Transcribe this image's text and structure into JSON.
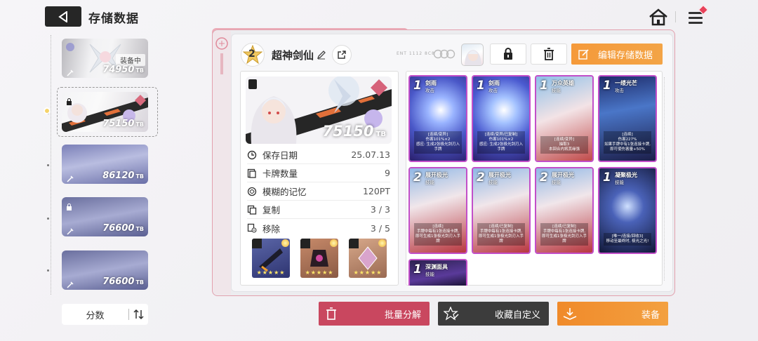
{
  "header": {
    "title": "存储数据"
  },
  "saves": [
    {
      "value": "74950",
      "unit": "TB",
      "tag": "装备中"
    },
    {
      "value": "75150",
      "unit": "TB",
      "locked": true,
      "selected": true
    },
    {
      "value": "86120",
      "unit": "TB"
    },
    {
      "value": "76600",
      "unit": "TB",
      "locked": true
    },
    {
      "value": "76600",
      "unit": "TB"
    }
  ],
  "sort": {
    "label": "分数"
  },
  "deck": {
    "grade": "2",
    "name": "超神剑仙",
    "tiny_caption": "ENT 1112 8C8",
    "edit_label": "编辑存储数据",
    "preview_value": "75150",
    "preview_unit": "TB"
  },
  "info": [
    {
      "label": "保存日期",
      "value": "25.07.13",
      "icon": "clock-icon"
    },
    {
      "label": "卡牌数量",
      "value": "9",
      "icon": "cards-icon"
    },
    {
      "label": "模糊的记忆",
      "value": "120PT",
      "icon": "memory-icon"
    },
    {
      "label": "复制",
      "value": "3 / 3",
      "icon": "copy-icon"
    },
    {
      "label": "移除",
      "value": "3 / 5",
      "icon": "remove-icon"
    }
  ],
  "relics": [
    {
      "name": "weapon",
      "stars": "★★★★★"
    },
    {
      "name": "armor",
      "stars": "★★★★★"
    },
    {
      "name": "ring",
      "stars": "★★★★★"
    }
  ],
  "cards": [
    {
      "cost": "1",
      "name": "剑雨",
      "type": "攻击",
      "desc": "[连续/变异]\n伤害101%×2\n感应: 生成2张极光剑刃入手牌"
    },
    {
      "cost": "1",
      "name": "剑雨",
      "type": "攻击",
      "desc": "[连续/变异/已复制]\n伤害101%×2\n感应: 生成2张极光剑刃入手牌"
    },
    {
      "cost": "1",
      "name": "万众英雄",
      "type": "技能",
      "desc": "[连续/变异]\n抽取3\n本回合内将其缘强"
    },
    {
      "cost": "1",
      "name": "一缕光芒",
      "type": "攻击",
      "desc": "[连续]\n伤害227%\n如果手牌中有1张连接卡牌, 即可使伤害量+50%"
    },
    {
      "cost": "2",
      "name": "展开极光",
      "type": "技能",
      "desc": "[连续]\n手牌中每有1张连接卡牌, 即可生成1张极光剑刃入手牌"
    },
    {
      "cost": "2",
      "name": "展开极光",
      "type": "技能",
      "desc": "[连续/已复制]\n手牌中每有1张连接卡牌, 即可生成1张极光剑刃入手牌"
    },
    {
      "cost": "2",
      "name": "展开极光",
      "type": "技能",
      "desc": "[连续/已复制]\n手牌中每有1张连接卡牌, 即可生成1张极光剑刃入手牌"
    },
    {
      "cost": "1",
      "name": "凝聚极光",
      "type": "技能",
      "desc": "[唯一/连接/回收3]\n移动至最终时, 极光之光!"
    },
    {
      "cost": "1",
      "name": "深渊面具",
      "type": "技能",
      "desc": ""
    }
  ],
  "buttons": {
    "batch": "批量分解",
    "favorite": "收藏自定义",
    "equip": "装备"
  },
  "colors": {
    "accent_orange": "#f39a3a",
    "danger_red": "#c9475f",
    "dark": "#3c3c3c",
    "card_border": "#c24fc9"
  }
}
